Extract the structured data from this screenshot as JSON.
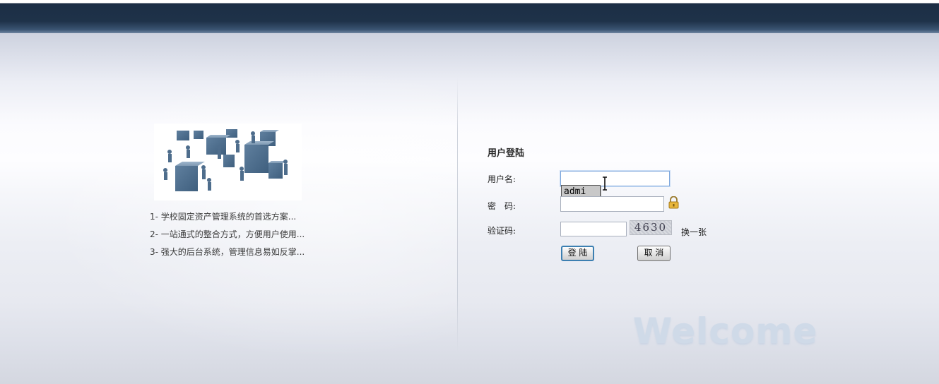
{
  "features": [
    "1- 学校固定资产管理系统的首选方案...",
    "2- 一站通式的整合方式，方便用户使用...",
    "3- 强大的后台系统，管理信息易如反掌..."
  ],
  "login": {
    "title": "用户登陆",
    "username_label": "用户名:",
    "username_value": "",
    "username_suggestion": "admi",
    "password_label": "密　码:",
    "password_value": "",
    "captcha_label": "验证码:",
    "captcha_value": "",
    "captcha_text": "4630",
    "refresh_label": "换一张",
    "login_button": "登 陆",
    "cancel_button": "取 消"
  },
  "welcome_text": "Welcome",
  "icons": {
    "illustration": "business-people-cubes-illustration",
    "lock": "lock-icon",
    "cursor": "text-cursor-icon"
  }
}
